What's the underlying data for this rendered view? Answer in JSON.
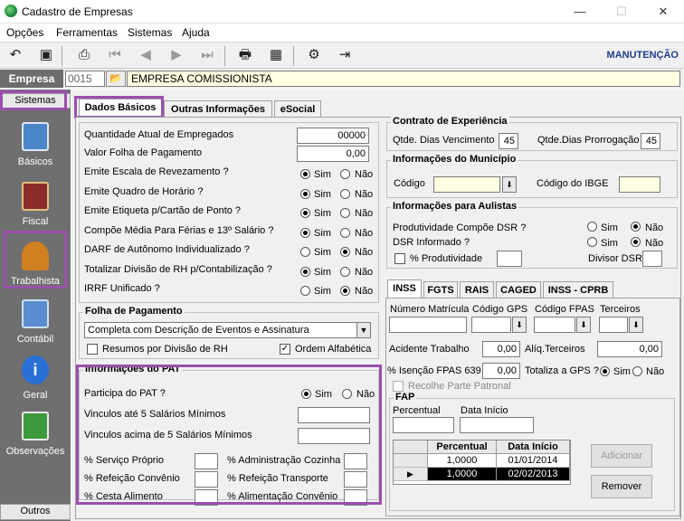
{
  "window": {
    "title": "Cadastro de Empresas",
    "minimize": "—",
    "maximize": "☐",
    "close": "✕"
  },
  "menu": [
    "Opções",
    "Ferramentas",
    "Sistemas",
    "Ajuda"
  ],
  "toolbar": {
    "mode": "MANUTENÇÃO"
  },
  "empresa": {
    "label": "Empresa",
    "code": "0015",
    "name": "EMPRESA COMISSIONISTA"
  },
  "sidebar": {
    "top": "Sistemas",
    "bottom": "Outros",
    "items": [
      {
        "label": "Básicos",
        "icon": "document-stack-icon",
        "color": "#4a86c8"
      },
      {
        "label": "Fiscal",
        "icon": "ledger-book-icon",
        "color": "#8b2b2b"
      },
      {
        "label": "Trabalhista",
        "icon": "worker-icon",
        "color": "#d08020"
      },
      {
        "label": "Contábil",
        "icon": "calculator-icon",
        "color": "#5a8cd0"
      },
      {
        "label": "Geral",
        "icon": "info-icon",
        "color": "#2a6fd6"
      },
      {
        "label": "Observações",
        "icon": "notepad-pencil-icon",
        "color": "#3c9a3c"
      }
    ]
  },
  "tabs": [
    "Dados Básicos",
    "Outras Informações",
    "eSocial"
  ],
  "left": {
    "fields": [
      {
        "label": "Quantidade Atual de Empregados",
        "value": "00000"
      },
      {
        "label": "Valor Folha de Pagamento",
        "value": "0,00"
      }
    ],
    "radios": [
      {
        "label": "Emite Escala de Revezamento ?",
        "sim": true
      },
      {
        "label": "Emite Quadro de Horário ?",
        "sim": true
      },
      {
        "label": "Emite Etiqueta p/Cartão de Ponto ?",
        "sim": true
      },
      {
        "label": "Compõe Média Para Férias e 13º Salário ?",
        "sim": true
      },
      {
        "label": "DARF de Autônomo Individualizado ?",
        "sim": false
      },
      {
        "label": "Totalizar Divisão de RH p/Contabilização ?",
        "sim": true
      },
      {
        "label": "IRRF Unificado ?",
        "sim": false
      }
    ],
    "sim": "Sim",
    "nao": "Não"
  },
  "folha": {
    "title": "Folha de Pagamento",
    "option": "Completa com Descrição de Eventos e Assinatura",
    "resumos": "Resumos por Divisão de RH",
    "ordem": "Ordem Alfabética"
  },
  "pat": {
    "title": "Informações do PAT",
    "participa": "Participa do PAT ?",
    "vinc1": "Vinculos até 5 Salários Mínimos",
    "vinc2": "Vinculos acima de 5 Salários Mínimos",
    "items": [
      [
        "% Serviço Próprio",
        "% Administração Cozinha"
      ],
      [
        "% Refeição Convênio",
        "% Refeição Transporte"
      ],
      [
        "% Cesta Alimento",
        "% Alimentação Convênio"
      ]
    ]
  },
  "contrato": {
    "title": "Contrato de Experiência",
    "venc_label": "Qtde. Dias Vencimento",
    "venc": "45",
    "prorr_label": "Qtde.Dias Prorrogação",
    "prorr": "45"
  },
  "municipio": {
    "title": "Informações do Município",
    "codigo": "Código",
    "ibge": "Código do IBGE"
  },
  "aulistas": {
    "title": "Informações para Aulistas",
    "prod": "Produtividade Compõe DSR ?",
    "dsr": "DSR Informado ?",
    "perc": "% Produtividade",
    "divisor": "Divisor DSR"
  },
  "subtabs": [
    "INSS",
    "FGTS",
    "RAIS",
    "CAGED",
    "INSS - CPRB"
  ],
  "inss": {
    "matricula": "Número Matrícula",
    "gps": "Código GPS",
    "fpas": "Código FPAS",
    "terceiros": "Terceiros",
    "acidente": "Acidente Trabalho",
    "acidente_v": "0,00",
    "aliq": "Alíq.Terceiros",
    "aliq_v": "0,00",
    "isencao": "% Isenção FPAS 639",
    "isencao_v": "0,00",
    "totaliza": "Totaliza a GPS ?",
    "recolhe": "Recolhe Parte Patronal"
  },
  "fap": {
    "title": "FAP",
    "percentual": "Percentual",
    "data": "Data Início",
    "headers": [
      "Percentual",
      "Data Início"
    ],
    "rows": [
      [
        "1,0000",
        "01/01/2014"
      ],
      [
        "1,0000",
        "02/02/2013"
      ]
    ],
    "adicionar": "Adicionar",
    "remover": "Remover"
  },
  "highlight_color": "#9b4fae"
}
